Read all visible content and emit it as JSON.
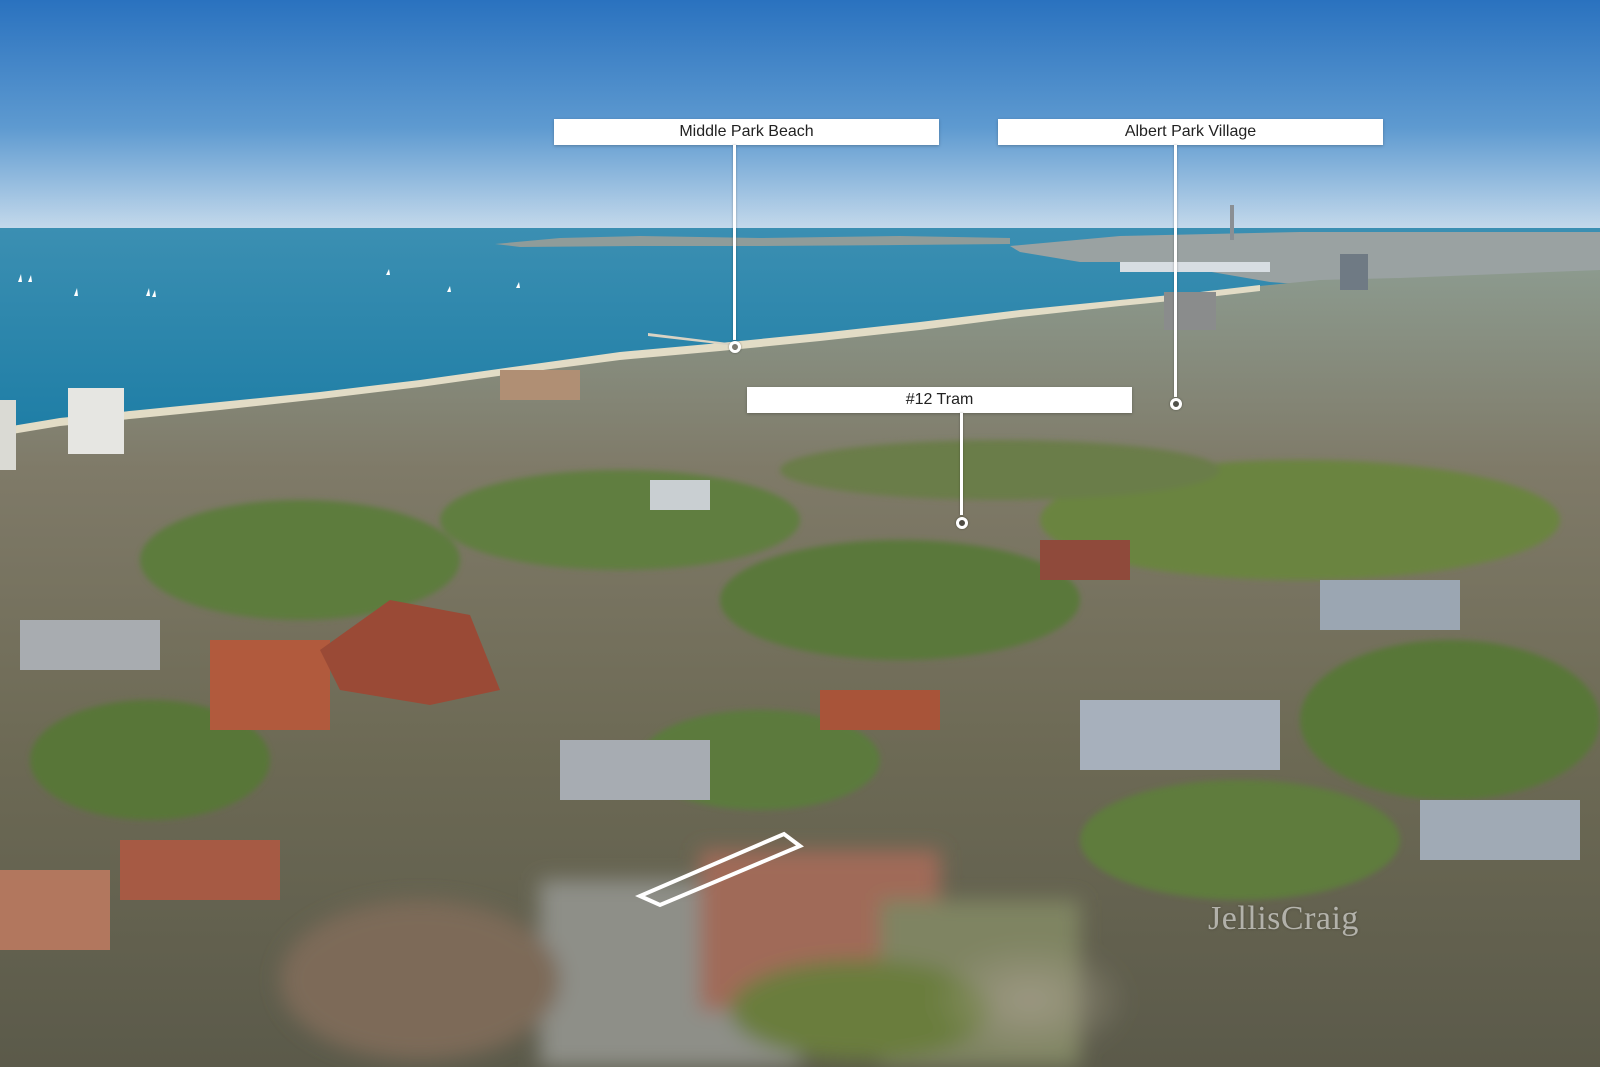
{
  "photo": {
    "subject": "aerial-suburb-bay-view",
    "colors": {
      "sky_top": "#2c78c4",
      "sky_horizon": "#c9dcec",
      "water": "#2f8cb0",
      "sand": "#e4ddc8",
      "trees": "#5a7a3a",
      "roofs_red": "#a9553a",
      "roofs_grey": "#8e96a0"
    }
  },
  "callouts": [
    {
      "label": "Middle Park Beach"
    },
    {
      "label": "Albert Park Village"
    },
    {
      "label": "#12 Tram"
    }
  ],
  "watermark": {
    "text": "JellisCraig"
  }
}
